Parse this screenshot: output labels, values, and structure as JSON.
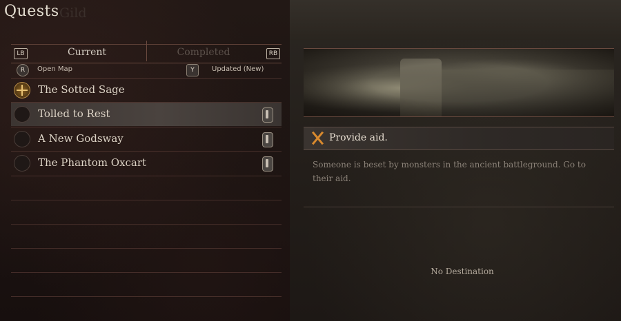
{
  "screen": {
    "title": "Quests",
    "faded_title": "Gild"
  },
  "tabs": {
    "left_badge": "LB",
    "right_badge": "RB",
    "items": [
      {
        "label": "Current",
        "state": "active"
      },
      {
        "label": "Completed",
        "state": "inactive"
      }
    ]
  },
  "controls": {
    "map_button": "R",
    "map_label": "Open Map",
    "sort_button": "Y",
    "sort_label": "Updated (New)"
  },
  "quests": [
    {
      "name": "The Sotted Sage",
      "icon": "active-quest-icon",
      "tag": false,
      "selected": false
    },
    {
      "name": "Tolled to Rest",
      "icon": "quest-icon",
      "tag": true,
      "selected": true
    },
    {
      "name": "A New Godsway",
      "icon": "quest-icon",
      "tag": true,
      "selected": false
    },
    {
      "name": "The Phantom Oxcart",
      "icon": "quest-icon",
      "tag": true,
      "selected": false
    }
  ],
  "detail": {
    "image_icon": "ruined-castle-image",
    "objective_icon": "crossed-swords-icon",
    "objective": "Provide aid.",
    "description": "Someone is beset by monsters in the ancient battleground. Go to their aid.",
    "destination": "No Destination"
  },
  "colors": {
    "objective_icon": "#d98a2e",
    "active_quest_icon": "#e8c274"
  }
}
